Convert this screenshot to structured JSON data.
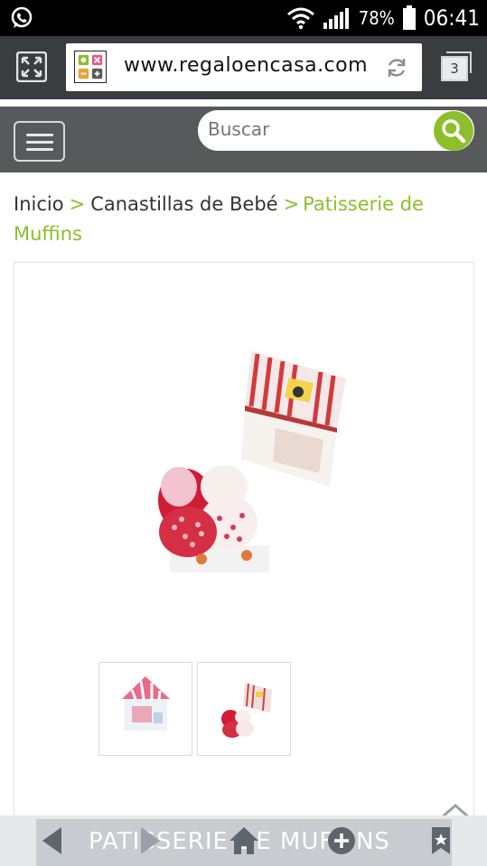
{
  "status_bar": {
    "battery": "78%",
    "time": "06:41"
  },
  "browser": {
    "url": "www.regaloencasa.com",
    "tab_count": "3"
  },
  "header": {
    "search_placeholder": "Buscar"
  },
  "breadcrumb": {
    "items": [
      "Inicio",
      "Canastillas de Bebé"
    ],
    "separator": ">",
    "current": "Patisserie de Muffins"
  },
  "bottom_nav": {
    "title": "PATISSERIE DE MUFFINS"
  },
  "colors": {
    "accent": "#8cbf2b",
    "header_bg": "#58595b",
    "browser_bg": "#3a3d40"
  }
}
